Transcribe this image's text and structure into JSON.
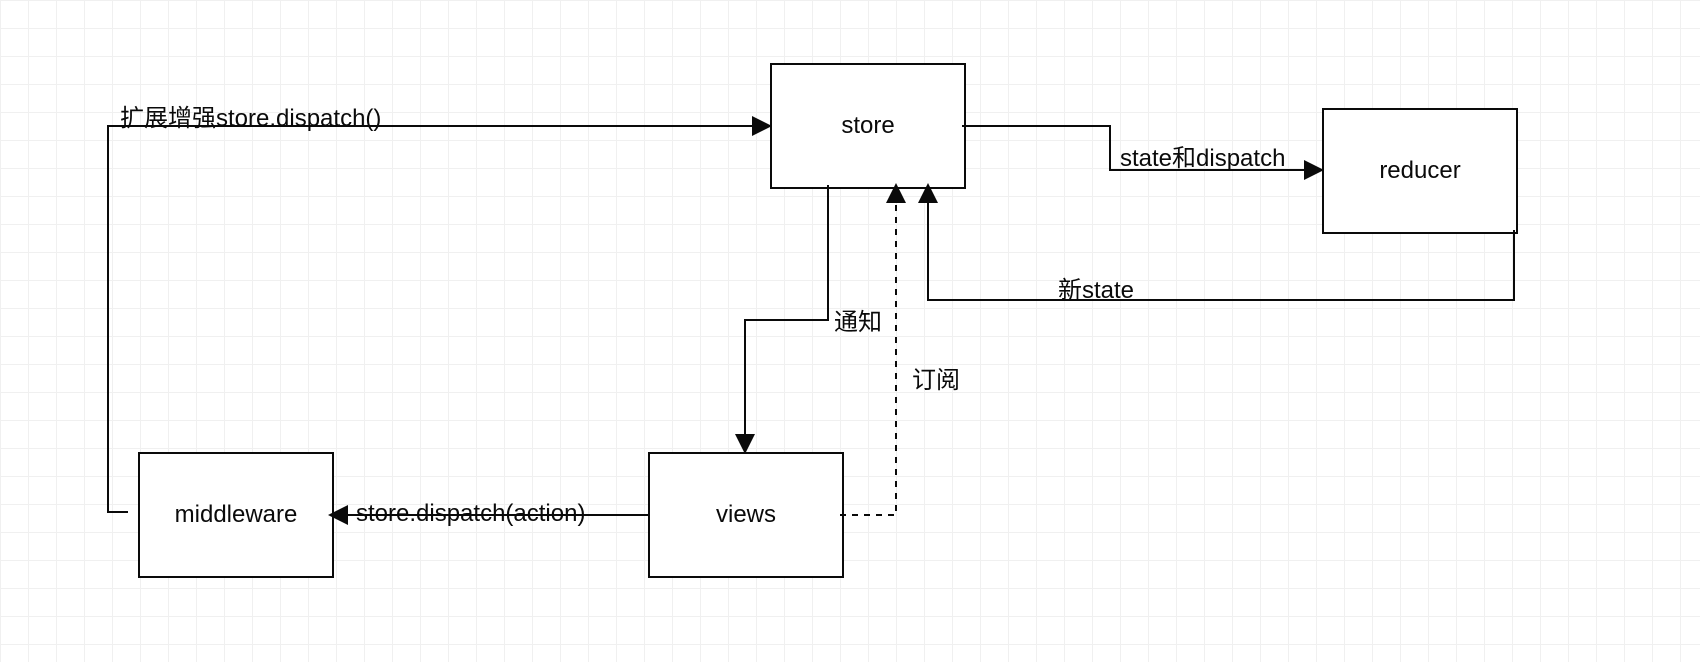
{
  "nodes": {
    "store": {
      "label": "store"
    },
    "views": {
      "label": "views"
    },
    "middleware": {
      "label": "middleware"
    },
    "reducer": {
      "label": "reducer"
    }
  },
  "edges": {
    "enhance": {
      "label": "扩展增强store.dispatch()"
    },
    "stateDispatch": {
      "label": "state和dispatch"
    },
    "newState": {
      "label": "新state"
    },
    "notify": {
      "label": "通知"
    },
    "subscribe": {
      "label": "订阅"
    },
    "dispatch": {
      "label": "store.dispatch(action)"
    }
  }
}
